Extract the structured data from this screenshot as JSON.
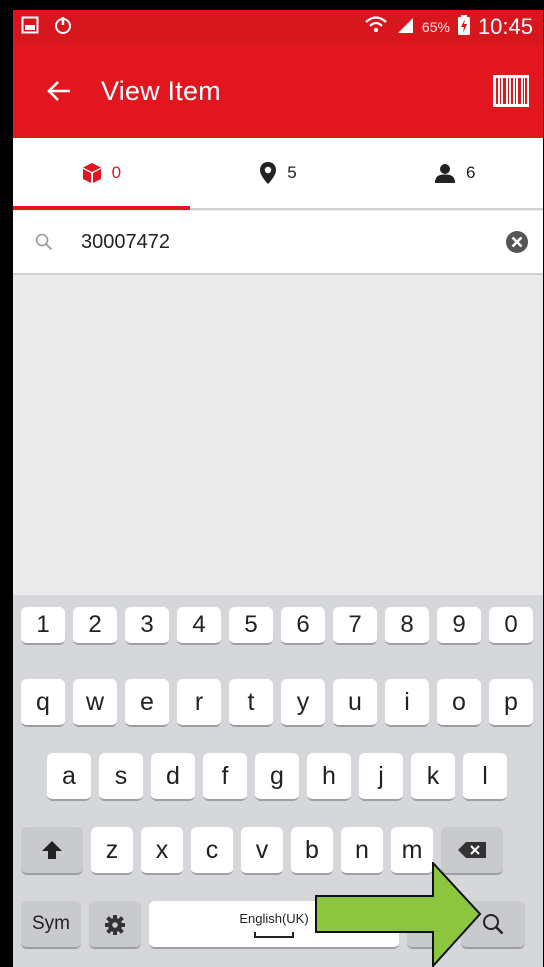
{
  "status_bar": {
    "battery_percent": "65%",
    "time": "10:45"
  },
  "app_bar": {
    "title": "View Item"
  },
  "tabs": [
    {
      "icon": "package-icon",
      "count": "0",
      "active": true
    },
    {
      "icon": "location-pin-icon",
      "count": "5",
      "active": false
    },
    {
      "icon": "person-icon",
      "count": "6",
      "active": false
    }
  ],
  "search": {
    "value": "30007472"
  },
  "keyboard": {
    "row_numbers": [
      "1",
      "2",
      "3",
      "4",
      "5",
      "6",
      "7",
      "8",
      "9",
      "0"
    ],
    "row_1": [
      "q",
      "w",
      "e",
      "r",
      "t",
      "y",
      "u",
      "i",
      "o",
      "p"
    ],
    "row_2": [
      "a",
      "s",
      "d",
      "f",
      "g",
      "h",
      "j",
      "k",
      "l"
    ],
    "row_3": [
      "z",
      "x",
      "c",
      "v",
      "b",
      "n",
      "m"
    ],
    "sym_label": "Sym",
    "space_label": "English(UK)"
  },
  "colors": {
    "brand_red": "#e1161f",
    "annotation_arrow": "#8cc63f"
  }
}
